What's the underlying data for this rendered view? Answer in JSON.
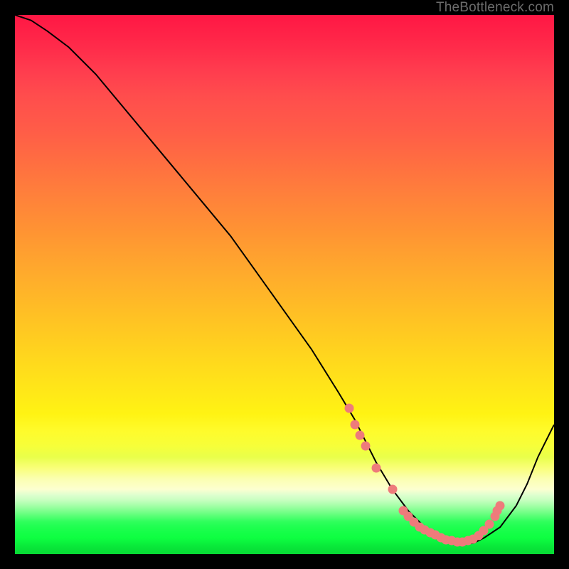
{
  "watermark": "TheBottleneck.com",
  "chart_data": {
    "type": "line",
    "title": "",
    "xlabel": "",
    "ylabel": "",
    "xlim": [
      0,
      100
    ],
    "ylim": [
      0,
      100
    ],
    "series": [
      {
        "name": "curve",
        "x": [
          0,
          3,
          6,
          10,
          15,
          20,
          25,
          30,
          35,
          40,
          45,
          50,
          55,
          60,
          63,
          65,
          67,
          70,
          73,
          76,
          79,
          82,
          85,
          87,
          90,
          93,
          95,
          97,
          100
        ],
        "y": [
          100,
          99,
          97,
          94,
          89,
          83,
          77,
          71,
          65,
          59,
          52,
          45,
          38,
          30,
          25,
          21,
          17,
          12,
          8,
          5,
          3,
          2,
          2,
          3,
          5,
          9,
          13,
          18,
          24
        ]
      }
    ],
    "markers": {
      "name": "highlight-points",
      "color": "#ee7b7b",
      "x": [
        62,
        63,
        64,
        65,
        67,
        70,
        72,
        73,
        74,
        75,
        76,
        77,
        78,
        79,
        80,
        81,
        82,
        83,
        84,
        85,
        86,
        87,
        88,
        89,
        89.5,
        90
      ],
      "y": [
        27,
        24,
        22,
        20,
        16,
        12,
        8,
        7,
        6,
        5,
        4.5,
        4,
        3.5,
        3,
        2.7,
        2.5,
        2.3,
        2.3,
        2.5,
        2.8,
        3.4,
        4.3,
        5.5,
        7,
        8,
        9
      ]
    },
    "colors": {
      "curve": "#000000",
      "marker": "#ee7b7b",
      "gradient_top": "#ff1744",
      "gradient_bottom": "#07d934"
    }
  }
}
